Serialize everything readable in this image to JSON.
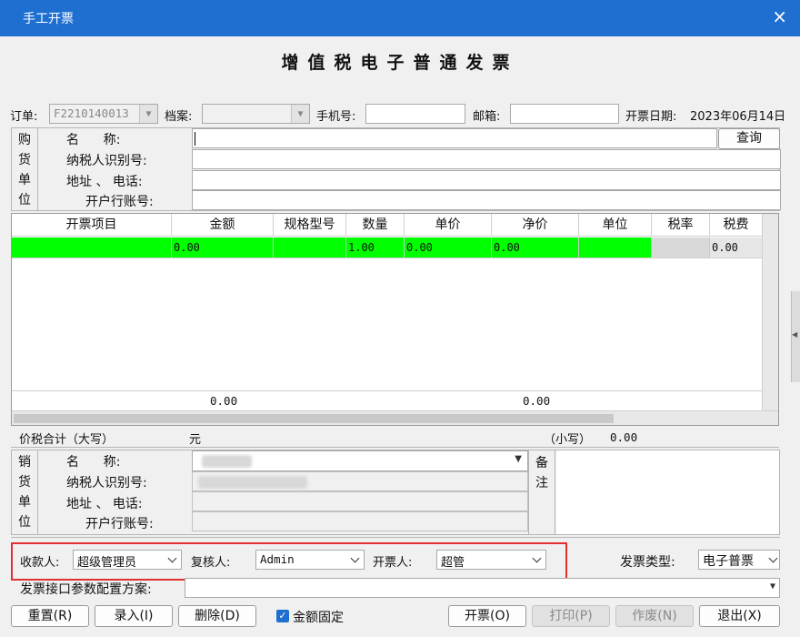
{
  "window": {
    "title": "手工开票",
    "close_icon": "×"
  },
  "invoice_title": "增值税电子普通发票",
  "top_row": {
    "order_label": "订单:",
    "order_value": "F2210140013",
    "archive_label": "档案:",
    "archive_value": "",
    "phone_label": "手机号:",
    "phone_value": "",
    "email_label": "邮箱:",
    "email_value": "",
    "date_label": "开票日期:",
    "date_value": "2023年06月14日"
  },
  "buyer": {
    "section_chars": [
      "购",
      "货",
      "单",
      "位"
    ],
    "name_label": "名      称:",
    "tax_id_label": "纳税人识别号:",
    "address_label": "地址 、 电话:",
    "bank_label": "开户行账号:",
    "query_button": "查询"
  },
  "items_table": {
    "headers": [
      "开票项目",
      "金额",
      "规格型号",
      "数量",
      "单价",
      "净价",
      "单位",
      "税率",
      "税费"
    ],
    "rows": [
      [
        "",
        "0.00",
        "",
        "1.00",
        "0.00",
        "0.00",
        "",
        "",
        "0.00"
      ]
    ],
    "total_amount": "0.00",
    "total_net": "0.00"
  },
  "totals": {
    "upper_label": "价税合计（大写）",
    "upper_value": "元",
    "lower_label": "（小写）",
    "lower_value": "0.00"
  },
  "seller": {
    "section_chars": [
      "销",
      "货",
      "单",
      "位"
    ],
    "name_label": "名      称:",
    "tax_id_label": "纳税人识别号:",
    "address_label": "地址 、 电话:",
    "bank_label": "开户行账号:",
    "remarks_chars": [
      "备",
      "注"
    ]
  },
  "people": {
    "payee_label": "收款人:",
    "payee_value": "超级管理员",
    "reviewer_label": "复核人:",
    "reviewer_value": "Admin",
    "issuer_label": "开票人:",
    "issuer_value": "超管",
    "invoice_type_label": "发票类型:",
    "invoice_type_value": "电子普票"
  },
  "config": {
    "label": "发票接口参数配置方案:",
    "value": ""
  },
  "buttons": {
    "reset": "重置(R)",
    "entry": "录入(I)",
    "delete": "删除(D)",
    "fixed_amount": "金额固定",
    "issue": "开票(O)",
    "print": "打印(P)",
    "void": "作废(N)",
    "exit": "退出(X)"
  },
  "colors": {
    "titlebar": "#1f6fd1",
    "row_highlight": "#00ff00",
    "annotation_box": "#e03030"
  }
}
